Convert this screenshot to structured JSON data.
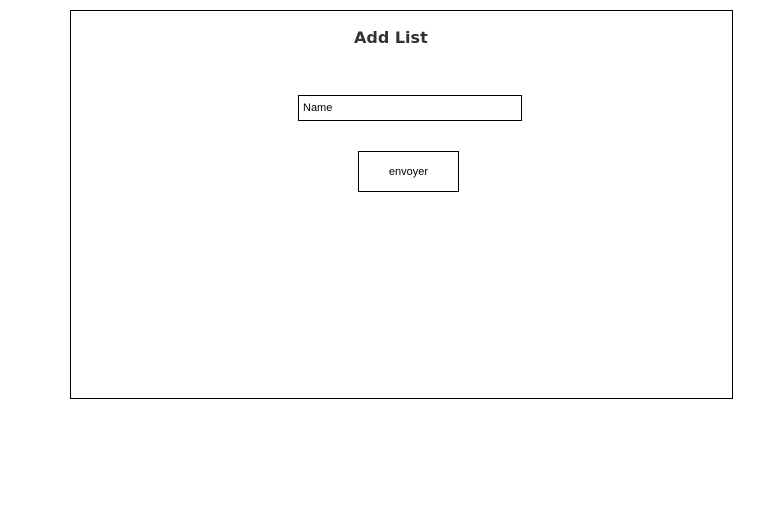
{
  "form": {
    "title": "Add List",
    "name_placeholder": "Name",
    "name_value": "",
    "submit_label": "envoyer"
  }
}
